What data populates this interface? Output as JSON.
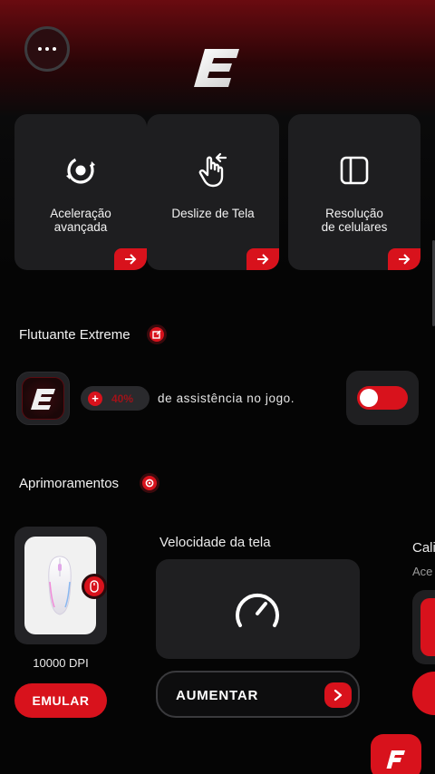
{
  "header": {
    "menu_icon": "more-dots-icon",
    "logo_letter": "E"
  },
  "cards": [
    {
      "label": "Aceleração\navançada",
      "icon": "target-cycle-icon"
    },
    {
      "label": "Deslize de Tela",
      "icon": "swipe-hand-icon"
    },
    {
      "label": "Resolução\nde celulares",
      "icon": "layout-panels-icon"
    }
  ],
  "flutuante": {
    "title": "Flutuante Extreme",
    "percent": "40%",
    "assist_text": "de assistência no jogo.",
    "toggle_on": true
  },
  "aprimoramentos": {
    "title": "Aprimoramentos",
    "mouse": {
      "dpi": "10000 DPI",
      "button": "EMULAR"
    },
    "speed": {
      "title": "Velocidade da tela",
      "button": "AUMENTAR"
    },
    "partial": {
      "title": "Cali",
      "subtitle": "Ace"
    }
  },
  "colors": {
    "accent": "#d8121c",
    "card": "#1e1e20",
    "background": "#050505"
  }
}
